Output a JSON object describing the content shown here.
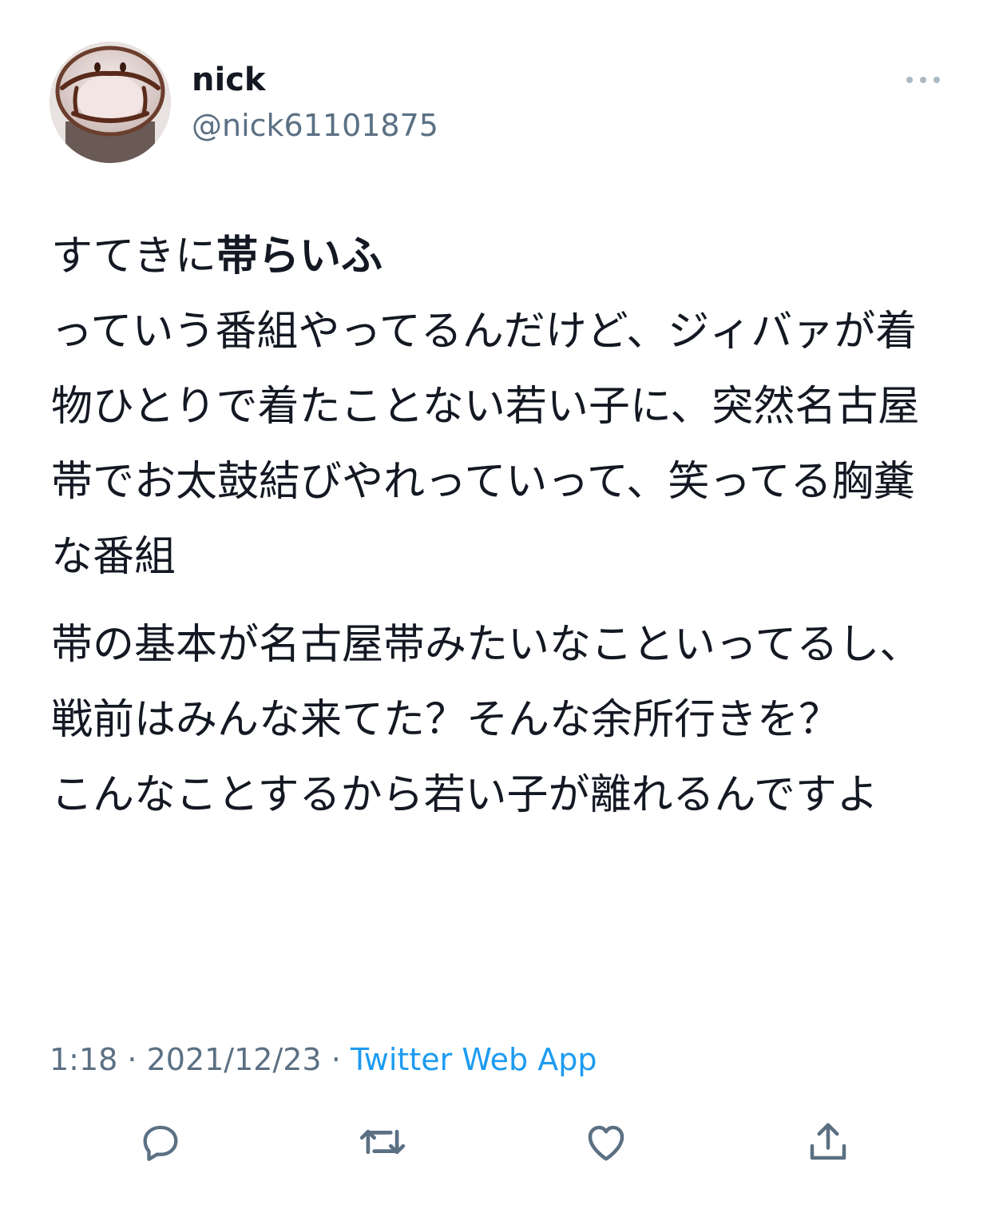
{
  "tweet": {
    "display_name": "nick",
    "handle": "@nick61101875",
    "paragraph1": {
      "intro": "すてきに",
      "bold": "帯らいふ",
      "rest": "\nっていう番組やってるんだけど、ジィバァが着物ひとりで着たことない若い子に、突然名古屋帯でお太鼓結びやれっていって、笑ってる胸糞な番組"
    },
    "paragraph2": "帯の基本が名古屋帯みたいなこといってるし、戦前はみんな来てた？そんな余所行きを？\nこんなことするから若い子が離れるんですよ",
    "time": "1:18",
    "separator": " · ",
    "date": "2021/12/23",
    "source": "Twitter Web App"
  },
  "icons": {
    "avatar": "avatar-image",
    "more": "more-dots-icon",
    "reply": "reply-icon",
    "retweet": "retweet-icon",
    "like": "heart-icon",
    "share": "share-icon"
  },
  "colors": {
    "text": "#141823",
    "secondary": "#5b7083",
    "link": "#1d9bf0",
    "icon": "#5b7083"
  }
}
